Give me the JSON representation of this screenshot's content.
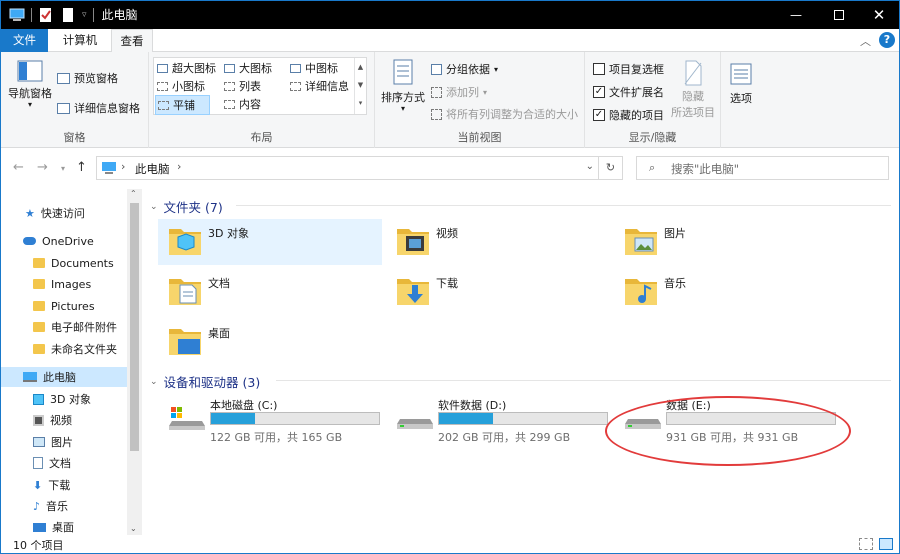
{
  "window": {
    "title": "此电脑",
    "controls": [
      "minimize",
      "maximize",
      "close"
    ]
  },
  "tabs": {
    "file": "文件",
    "computer": "计算机",
    "view": "查看",
    "active": "查看"
  },
  "ribbon": {
    "panes": {
      "nav_pane": "导航窗格",
      "preview": "预览窗格",
      "details": "详细信息窗格",
      "label": "窗格"
    },
    "layout": {
      "label": "布局",
      "items": [
        "超大图标",
        "大图标",
        "中图标",
        "小图标",
        "列表",
        "详细信息",
        "平铺",
        "内容"
      ],
      "selected": "平铺"
    },
    "current_view": {
      "label": "当前视图",
      "sort": "排序方式",
      "group": "分组依据",
      "add_column": "添加列",
      "fit_columns": "将所有列调整为合适的大小"
    },
    "show_hide": {
      "label": "显示/隐藏",
      "item_checkboxes": "项目复选框",
      "item_checkboxes_checked": false,
      "file_extensions": "文件扩展名",
      "file_extensions_checked": true,
      "hidden_items": "隐藏的项目",
      "hidden_items_checked": true,
      "hide_selected": "隐藏",
      "hide_selected2": "所选项目",
      "options": "选项"
    }
  },
  "address": {
    "path": "此电脑",
    "separator": "›",
    "search_placeholder": "搜索\"此电脑\""
  },
  "nav_pane": {
    "items": [
      {
        "label": "快速访问",
        "icon": "star-icon"
      },
      {
        "label": "OneDrive",
        "icon": "cloud-icon"
      },
      {
        "label": "Documents",
        "icon": "folder-icon"
      },
      {
        "label": "Images",
        "icon": "folder-icon"
      },
      {
        "label": "Pictures",
        "icon": "folder-icon"
      },
      {
        "label": "电子邮件附件",
        "icon": "folder-icon"
      },
      {
        "label": "未命名文件夹",
        "icon": "folder-icon"
      },
      {
        "label": "此电脑",
        "icon": "computer-icon",
        "selected": true
      },
      {
        "label": "3D 对象",
        "icon": "3d-icon"
      },
      {
        "label": "视频",
        "icon": "video-icon"
      },
      {
        "label": "图片",
        "icon": "picture-icon"
      },
      {
        "label": "文档",
        "icon": "document-icon"
      },
      {
        "label": "下载",
        "icon": "download-icon"
      },
      {
        "label": "音乐",
        "icon": "music-icon"
      },
      {
        "label": "桌面",
        "icon": "desktop-icon"
      }
    ]
  },
  "folders": {
    "header": "文件夹 (7)",
    "items": [
      {
        "name": "3D 对象",
        "icon": "3d-objects-folder-icon"
      },
      {
        "name": "视频",
        "icon": "videos-folder-icon"
      },
      {
        "name": "图片",
        "icon": "pictures-folder-icon"
      },
      {
        "name": "文档",
        "icon": "documents-folder-icon"
      },
      {
        "name": "下载",
        "icon": "downloads-folder-icon"
      },
      {
        "name": "音乐",
        "icon": "music-folder-icon"
      },
      {
        "name": "桌面",
        "icon": "desktop-folder-icon"
      }
    ]
  },
  "drives": {
    "header": "设备和驱动器 (3)",
    "items": [
      {
        "name": "本地磁盘 (C:)",
        "space": "122 GB 可用，共 165 GB",
        "used_fraction": 0.26,
        "system": true
      },
      {
        "name": "软件数据 (D:)",
        "space": "202 GB 可用，共 299 GB",
        "used_fraction": 0.32,
        "system": false
      },
      {
        "name": "数据 (E:)",
        "space": "931 GB 可用，共 931 GB",
        "used_fraction": 0.0,
        "system": false
      }
    ]
  },
  "status": {
    "count": "10 个项目"
  },
  "colors": {
    "accent": "#1979ca",
    "selection": "#cce8ff",
    "drive_fill": "#26a0da",
    "annotation": "#e23b3b"
  }
}
